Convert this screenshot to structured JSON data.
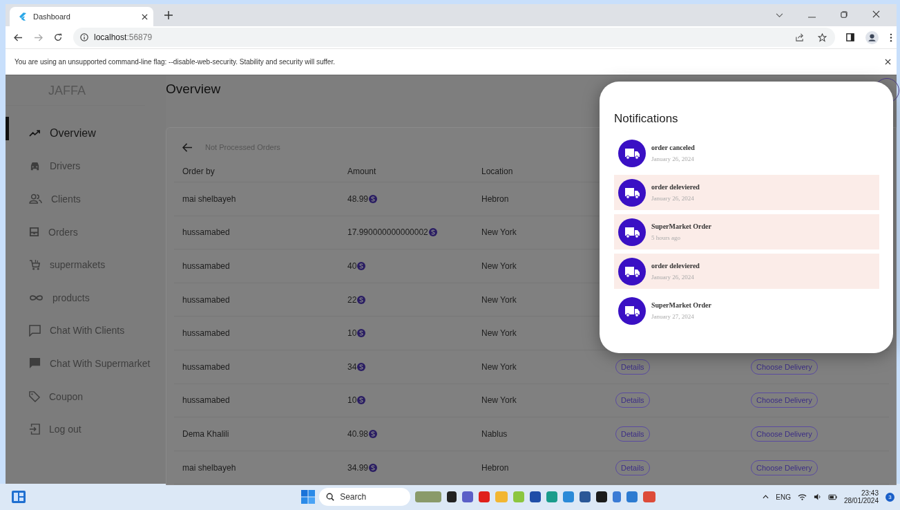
{
  "browser": {
    "tab_title": "Dashboard",
    "url_host": "localhost",
    "url_port": ":56879",
    "info_bar": "You are using an unsupported command-line flag: --disable-web-security. Stability and security will suffer."
  },
  "sidebar": {
    "logo": "JAFFA",
    "items": [
      {
        "label": "Overview",
        "selected": true
      },
      {
        "label": "Drivers",
        "selected": false
      },
      {
        "label": "Clients",
        "selected": false
      },
      {
        "label": "Orders",
        "selected": false
      },
      {
        "label": "supermakets",
        "selected": false
      },
      {
        "label": "products",
        "selected": false
      },
      {
        "label": "Chat With Clients",
        "selected": false
      },
      {
        "label": "Chat With Supermarket",
        "selected": false
      },
      {
        "label": "Coupon",
        "selected": false
      },
      {
        "label": "Log out",
        "selected": false
      }
    ]
  },
  "page_title": "Overview",
  "orders": {
    "title": "Not Processed Orders",
    "columns": [
      "Order by",
      "Amount",
      "Location"
    ],
    "rows": [
      {
        "order_by": "mai shelbayeh",
        "amount": "48.99",
        "location": "Hebron"
      },
      {
        "order_by": "hussamabed",
        "amount": "17.990000000000002",
        "location": "New York"
      },
      {
        "order_by": "hussamabed",
        "amount": "40",
        "location": "New York"
      },
      {
        "order_by": "hussamabed",
        "amount": "22",
        "location": "New York"
      },
      {
        "order_by": "hussamabed",
        "amount": "10",
        "location": "New York"
      },
      {
        "order_by": "hussamabed",
        "amount": "34",
        "location": "New York",
        "details": "Details",
        "choose": "Choose Delivery"
      },
      {
        "order_by": "hussamabed",
        "amount": "10",
        "location": "New York",
        "details": "Details",
        "choose": "Choose Delivery"
      },
      {
        "order_by": "Dema Khalili",
        "amount": "40.98",
        "location": "Nablus",
        "details": "Details",
        "choose": "Choose Delivery"
      },
      {
        "order_by": "mai shelbayeh",
        "amount": "34.99",
        "location": "Hebron",
        "details": "Details",
        "choose": "Choose Delivery"
      }
    ]
  },
  "notifications": {
    "title": "Notifications",
    "items": [
      {
        "title": "order canceled",
        "time": "January 26, 2024",
        "unread": false
      },
      {
        "title": "order deleviered",
        "time": "January 26, 2024",
        "unread": true
      },
      {
        "title": "SuperMarket Order",
        "time": "5 hours ago",
        "unread": true
      },
      {
        "title": "order deleviered",
        "time": "January 26, 2024",
        "unread": true
      },
      {
        "title": "SuperMarket Order",
        "time": "January 27, 2024",
        "unread": false
      }
    ]
  },
  "taskbar": {
    "search_placeholder": "Search",
    "language": "ENG",
    "time": "23:43",
    "date": "28/01/2024",
    "notification_count": "3"
  }
}
